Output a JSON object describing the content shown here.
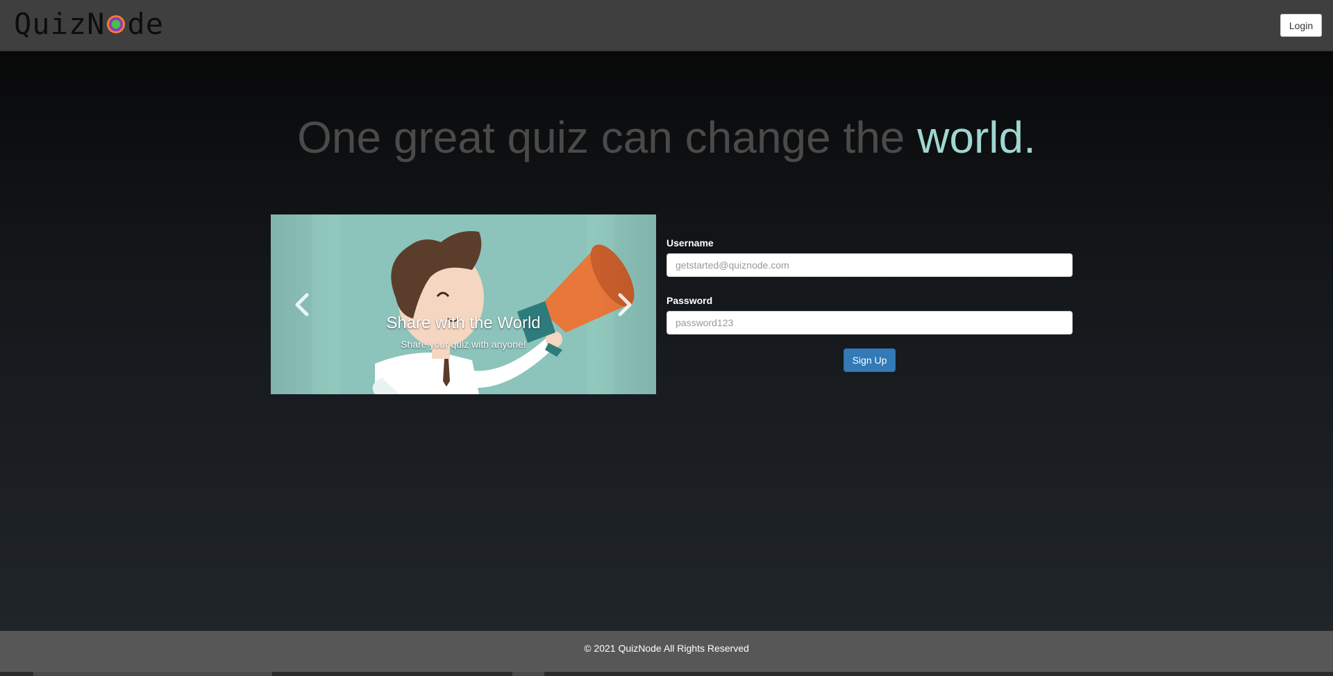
{
  "navbar": {
    "brand_prefix": "QuizN",
    "brand_suffix": "de",
    "login_label": "Login"
  },
  "hero": {
    "title_main": "One great quiz can change the ",
    "title_accent": "world."
  },
  "carousel": {
    "slide_title": "Share with the World",
    "slide_subtitle": "Share your quiz with anyone!",
    "prev_icon": "chevron-left-icon",
    "next_icon": "chevron-right-icon"
  },
  "signup_form": {
    "username_label": "Username",
    "username_placeholder": "getstarted@quiznode.com",
    "password_label": "Password",
    "password_placeholder": "password123",
    "submit_label": "Sign Up"
  },
  "footer": {
    "copyright": "© 2021 QuizNode All Rights Reserved"
  },
  "colors": {
    "accent": "#9fd6d2",
    "primary_button": "#337ab7",
    "navbar": "#3f3f3f",
    "footer": "#575757"
  }
}
